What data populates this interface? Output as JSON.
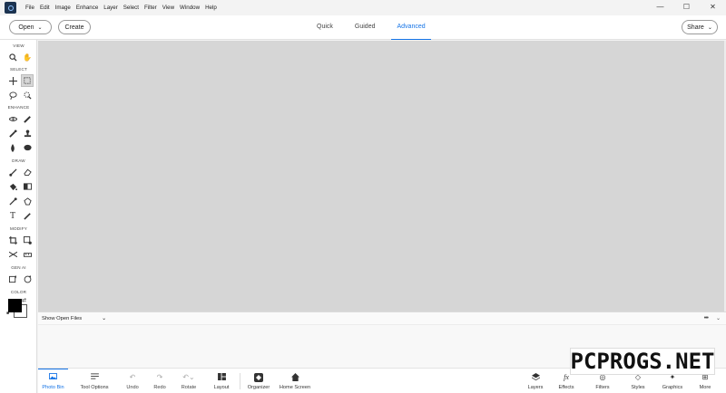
{
  "menu": [
    "File",
    "Edit",
    "Image",
    "Enhance",
    "Layer",
    "Select",
    "Filter",
    "View",
    "Window",
    "Help"
  ],
  "window_controls": {
    "minimize": "—",
    "maximize": "☐",
    "close": "✕"
  },
  "topbar": {
    "open_label": "Open",
    "create_label": "Create",
    "share_label": "Share",
    "modes": [
      "Quick",
      "Guided",
      "Advanced"
    ],
    "active_mode": "Advanced"
  },
  "toolbar": {
    "sections": {
      "view": "VIEW",
      "select": "SELECT",
      "enhance": "ENHANCE",
      "draw": "DRAW",
      "modify": "MODIFY",
      "gen_ai": "GEN AI",
      "color": "COLOR"
    },
    "tools": {
      "zoom": "zoom-icon",
      "hand": "hand-icon",
      "move": "move-icon",
      "marquee": "marquee-icon",
      "lasso": "lasso-icon",
      "quick_selection": "quick-selection-icon",
      "red_eye": "eye-icon",
      "spot_healing": "healing-brush-icon",
      "smart_brush": "smart-brush-icon",
      "clone_stamp": "clone-stamp-icon",
      "blur": "blur-drop-icon",
      "sponge": "sponge-icon",
      "brush": "brush-icon",
      "eraser": "eraser-icon",
      "paint_bucket": "paint-bucket-icon",
      "gradient": "gradient-icon",
      "eyedropper": "eyedropper-icon",
      "custom_shape": "custom-shape-icon",
      "type": "type-icon",
      "pencil": "pencil-icon",
      "crop": "crop-icon",
      "recompose": "recompose-icon",
      "content_aware_move": "content-aware-move-icon",
      "straighten": "straighten-icon",
      "generative_fill": "generative-fill-icon",
      "generative_remove": "generative-remove-icon"
    },
    "foreground_color": "#000000",
    "background_color": "#ffffff"
  },
  "photo_bin": {
    "show_label": "Show Open Files"
  },
  "bottombar": {
    "photo_bin": "Photo Bin",
    "tool_options": "Tool Options",
    "undo": "Undo",
    "redo": "Redo",
    "rotate": "Rotate",
    "layout": "Layout",
    "organizer": "Organizer",
    "home_screen": "Home Screen",
    "layers": "Layers",
    "effects": "Effects",
    "filters": "Filters",
    "styles": "Styles",
    "graphics": "Graphics",
    "more": "More"
  },
  "watermark": "PCPROGS.NET",
  "colors": {
    "accent": "#1473e6",
    "canvas": "#d6d6d6"
  }
}
